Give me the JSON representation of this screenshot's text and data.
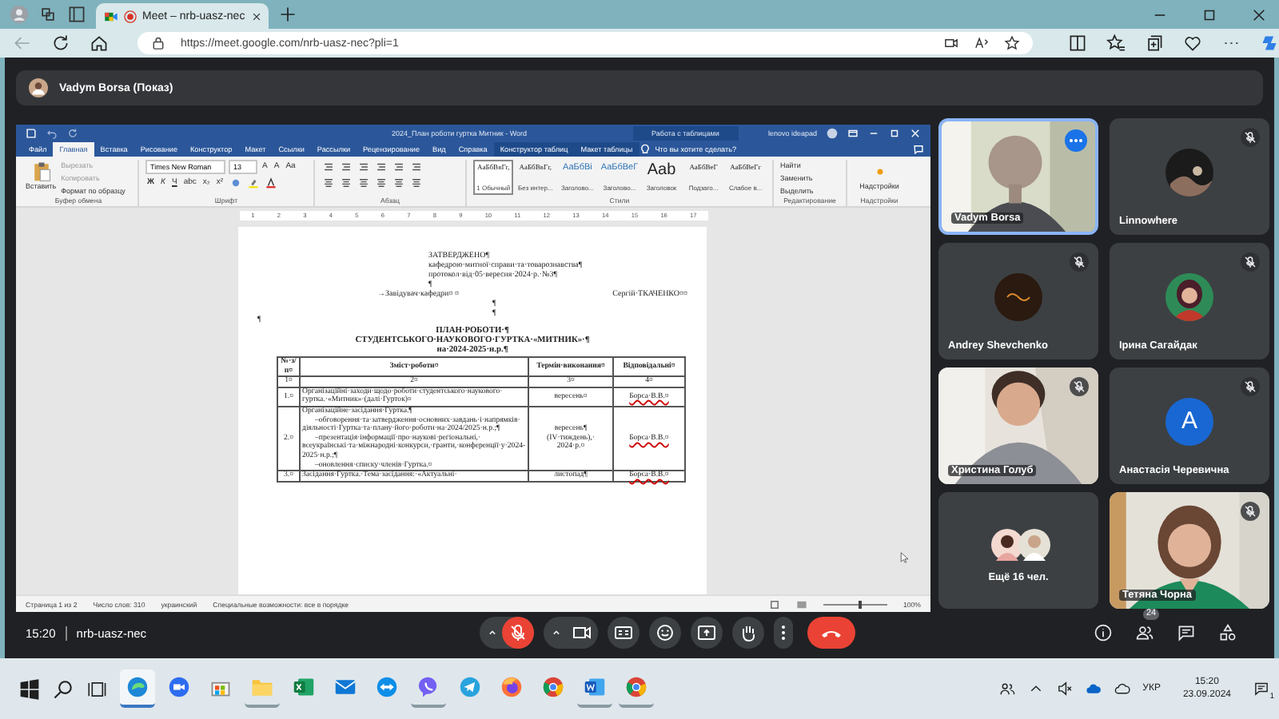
{
  "browser": {
    "tabs": [
      {
        "title": "Meet – nrb-uasz-nec",
        "selected": true,
        "recording": true
      }
    ],
    "url": "https://meet.google.com/nrb-uasz-nec?pli=1"
  },
  "meet": {
    "presenter": "Vadym Borsa (Показ)"
  },
  "word": {
    "title": "2024_План роботи гуртка Митник  -  Word",
    "context_tab": "Работа с таблицами",
    "user": "lenovo ideapad",
    "tabs": [
      {
        "label": "Файл",
        "selected": false,
        "context": false
      },
      {
        "label": "Главная",
        "selected": true,
        "context": false
      },
      {
        "label": "Вставка",
        "selected": false,
        "context": false
      },
      {
        "label": "Рисование",
        "selected": false,
        "context": false
      },
      {
        "label": "Конструктор",
        "selected": false,
        "context": false
      },
      {
        "label": "Макет",
        "selected": false,
        "context": false
      },
      {
        "label": "Ссылки",
        "selected": false,
        "context": false
      },
      {
        "label": "Рассылки",
        "selected": false,
        "context": false
      },
      {
        "label": "Рецензирование",
        "selected": false,
        "context": false
      },
      {
        "label": "Вид",
        "selected": false,
        "context": false
      },
      {
        "label": "Справка",
        "selected": false,
        "context": false
      },
      {
        "label": "Конструктор таблиц",
        "selected": false,
        "context": true
      },
      {
        "label": "Макет таблицы",
        "selected": false,
        "context": true
      }
    ],
    "search": "Что вы хотите сделать?",
    "clipboard": {
      "paste": "Вставить",
      "cut": "Вырезать",
      "copy": "Копировать",
      "format": "Формат по образцу"
    },
    "font": {
      "name": "Times New Roman",
      "size": "13",
      "size_buttons": [
        "A",
        "A",
        "Aa"
      ],
      "format_buttons": [
        "Ж",
        "К",
        "Ч",
        "abc",
        "x₂",
        "x²"
      ]
    },
    "styles": [
      {
        "sample": "АаБбВвГг,",
        "name": "1 Обычный",
        "selected": true
      },
      {
        "sample": "АаБбВвГг,",
        "name": "Без интер...",
        "selected": false
      },
      {
        "sample": "АаБбВі",
        "name": "Заголово...",
        "selected": false
      },
      {
        "sample": "АаБбВеГ",
        "name": "Заголово...",
        "selected": false
      },
      {
        "sample": "Aab",
        "name": "Заголовок",
        "selected": false
      },
      {
        "sample": "АаБбВеГ",
        "name": "Подзаго...",
        "selected": false
      },
      {
        "sample": "АаБбВеГг",
        "name": "Слабое в...",
        "selected": false
      }
    ],
    "editing": [
      "Найти",
      "Заменить",
      "Выделить"
    ],
    "addins": "Надстройки",
    "groups": [
      "Буфер обмена",
      "Шрифт",
      "Абзац",
      "Стили",
      "Редактирование",
      "Надстройки"
    ],
    "ruler": [
      "1",
      "2",
      "3",
      "4",
      "5",
      "6",
      "7",
      "8",
      "9",
      "10",
      "11",
      "12",
      "13",
      "14",
      "15",
      "16",
      "17"
    ],
    "status": [
      "Страница 1 из 2",
      "Число слов: 310",
      "украинский",
      "Специальные возможности: все в порядке"
    ],
    "zoom": {
      "label": "100%",
      "level": 0.55
    }
  },
  "document": {
    "approval": [
      "ЗАТВЕРДЖЕНО¶",
      "кафедрою·митної·справи·та·товарознавства¶",
      "протокол·від·05·вересня·2024·р.·№3¶",
      "¶"
    ],
    "head_role": "→Завідувач·кафедри¤ ¤",
    "head_name": "Сергій·ТКАЧЕНКО¤¤",
    "marks": [
      "¶",
      "¶"
    ],
    "left_mark": "¶",
    "title": [
      "ПЛАН·РОБОТИ·¶",
      "СТУДЕНТСЬКОГО·НАУКОВОГО·ГУРТКА·«МИТНИК»·¶",
      "на·2024-2025·н.р.¶"
    ],
    "columns": [
      "№·з/п¤",
      "Зміст·роботи¤",
      "Термін·виконання¤",
      "Відповідальні¤"
    ],
    "numbers": [
      "1¤",
      "2¤",
      "3¤",
      "4¤"
    ],
    "rows": [
      {
        "no": "1.¤",
        "content": [
          "Організаційні·заходи·щодо·роботи·студентського·наукового·гуртка.·«Митник»·(далі·Гурток)¤"
        ],
        "term": [
          "вересень¤"
        ],
        "resp": "Борса·В.В.¤"
      },
      {
        "no": "2.¤",
        "content": [
          "Організаційне·засідання·Гуртка.¶",
          "–обговорення·та·затвердження·основних·завдань·і·напрямків·діяльності·Гуртка·та·плану·його·роботи·на·2024/2025·н.р.;¶",
          "–презентація·інформації·про·наукові·регіональні,·всеукраїнські·та·міжнародні·конкурси,·гранти,·конференції·у·2024-2025·н.р.;¶",
          "–оновлення·списку·членів·Гуртка.¤"
        ],
        "term": [
          "вересень¶",
          "(IV·тиждень),·",
          "2024·р.¤"
        ],
        "resp": "Борса·В.В.¤"
      },
      {
        "no": "3.¤",
        "content": [
          "Засідання·Гуртка.·Тема·засідання:·«Актуальні·"
        ],
        "term": [
          "листопад¶"
        ],
        "resp": "Борса·В.В.¤"
      }
    ]
  },
  "participants": [
    {
      "name": "Vadym Borsa",
      "kind": "video",
      "muted": false,
      "highlighted": true
    },
    {
      "name": "Linnowhere",
      "muted": true,
      "highlighted": false
    },
    {
      "name": "Andrey Shevchenko",
      "kind": "logo",
      "muted": true,
      "highlighted": false
    },
    {
      "name": "Ірина Сагайдак",
      "muted": true,
      "highlighted": false
    },
    {
      "name": "Христина Голуб",
      "kind": "video",
      "muted": true,
      "highlighted": false
    },
    {
      "name": "Анастасія Черевична",
      "kind": "letter",
      "letter": "A",
      "muted": true,
      "highlighted": false
    },
    {
      "name": "Ещё 16 чел.",
      "kind": "more",
      "muted": false,
      "highlighted": false
    },
    {
      "name": "Тетяна Чорна",
      "kind": "video",
      "muted": true,
      "highlighted": false
    }
  ],
  "controls": {
    "time": "15:20",
    "meeting_code": "nrb-uasz-nec",
    "mic_on": false,
    "camera_on": true,
    "captions_on": false,
    "hand_raised": false,
    "people_count": "24"
  },
  "taskbar": {
    "apps": [
      {
        "kind": "edge",
        "running": true,
        "selected": true
      },
      {
        "kind": "zoom",
        "running": false,
        "selected": false
      },
      {
        "kind": "store",
        "running": false,
        "selected": false
      },
      {
        "kind": "explorer",
        "running": true,
        "selected": false
      },
      {
        "kind": "excel",
        "running": false,
        "selected": false
      },
      {
        "kind": "mail",
        "running": false,
        "selected": false
      },
      {
        "kind": "teamviewer",
        "running": false,
        "selected": false
      },
      {
        "kind": "viber",
        "running": true,
        "selected": false
      },
      {
        "kind": "telegram",
        "running": false,
        "selected": false
      },
      {
        "kind": "firefox",
        "running": false,
        "selected": false
      },
      {
        "kind": "chrome",
        "running": false,
        "selected": false
      },
      {
        "kind": "word",
        "running": true,
        "selected": false
      },
      {
        "kind": "chrome",
        "running": true,
        "selected": false
      }
    ],
    "language": "УКР",
    "time": "15:20",
    "date": "23.09.2024",
    "notifications": "1"
  }
}
